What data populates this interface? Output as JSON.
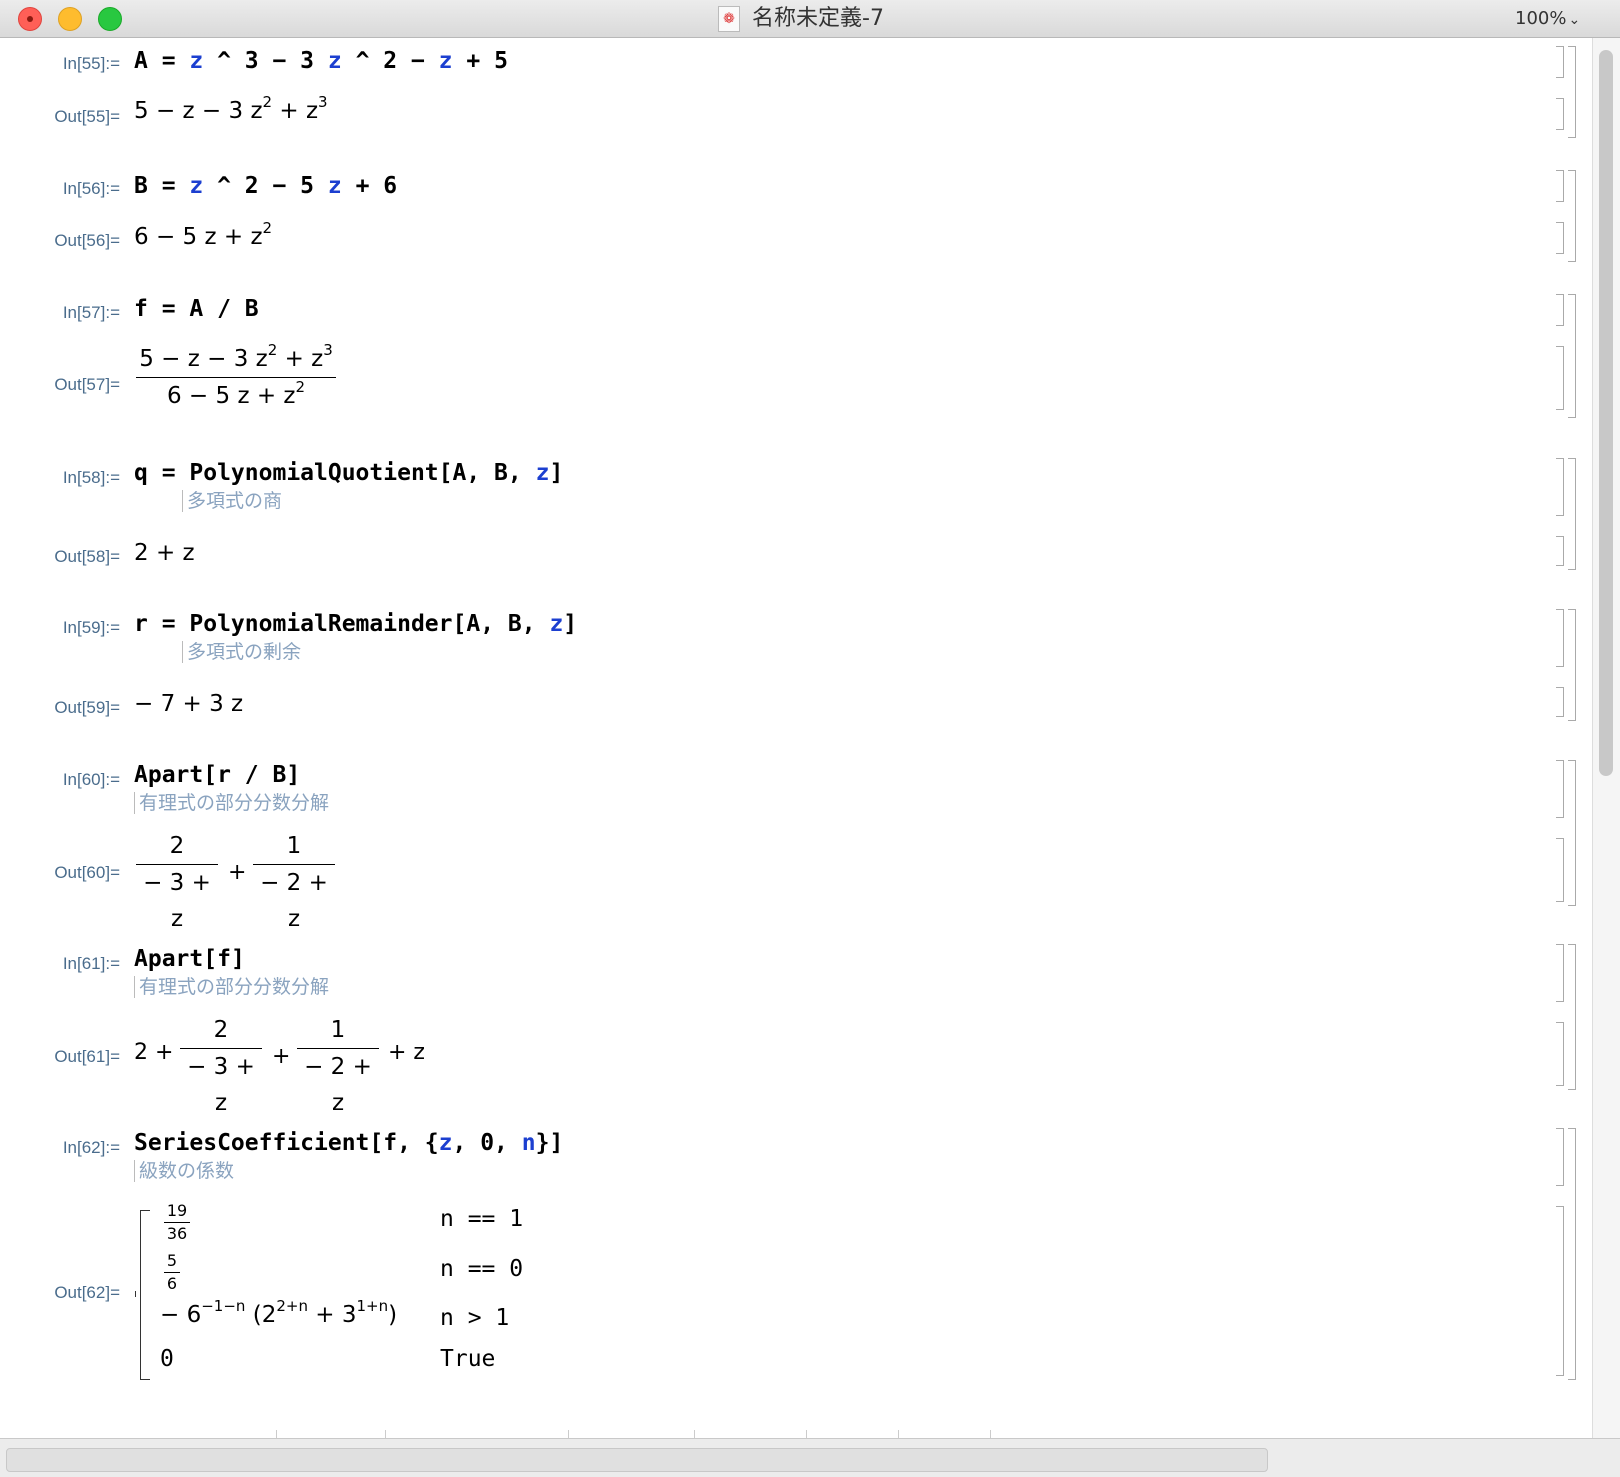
{
  "window": {
    "title": "名称未定義-7",
    "zoom": "100%"
  },
  "cells": {
    "c55": {
      "in_label": "In[55]:=",
      "out_label": "Out[55]="
    },
    "c56": {
      "in_label": "In[56]:=",
      "out_label": "Out[56]="
    },
    "c57": {
      "in_label": "In[57]:=",
      "out_label": "Out[57]="
    },
    "c58": {
      "in_label": "In[58]:=",
      "out_label": "Out[58]=",
      "hint": "多項式の商",
      "func": "PolynomialQuotient"
    },
    "c59": {
      "in_label": "In[59]:=",
      "out_label": "Out[59]=",
      "hint": "多項式の剰余",
      "func": "PolynomialRemainder"
    },
    "c60": {
      "in_label": "In[60]:=",
      "out_label": "Out[60]=",
      "hint": "有理式の部分分数分解",
      "func": "Apart"
    },
    "c61": {
      "in_label": "In[61]:=",
      "out_label": "Out[61]=",
      "hint": "有理式の部分分数分解",
      "func": "Apart"
    },
    "c62": {
      "in_label": "In[62]:=",
      "out_label": "Out[62]=",
      "hint": "級数の係数",
      "func": "SeriesCoefficient"
    }
  },
  "math": {
    "frac2": "2",
    "frac1": "1",
    "den_m3z": "− 3 + z",
    "den_m2z": "− 2 + z",
    "plus": "+",
    "two_plus": "2 +",
    "plus_z": "+ z",
    "out58": "2 + z",
    "out59": "− 7 + 3 z",
    "f57_den": "6 − 5 z + z",
    "pw": {
      "p1_num": "19",
      "p1_den": "36",
      "c1": "n == 1",
      "p2_num": "5",
      "p2_den": "6",
      "c2": "n == 0",
      "p3": "− 6",
      "p3_exp": "−1−n",
      "c3": "n > 1",
      "p4": "0",
      "c4": "True"
    }
  },
  "colors": {
    "variable": "#1c3fd0",
    "label": "#4a6c8c",
    "hint": "#8aa3bf"
  }
}
